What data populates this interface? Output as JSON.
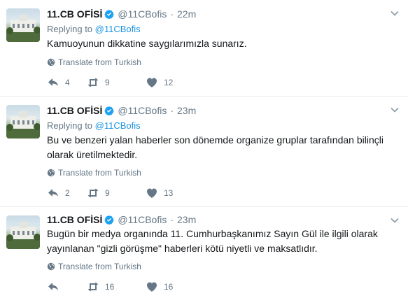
{
  "tweets": [
    {
      "name": "11.CB OFİSİ",
      "handle": "@11CBofis",
      "separator": "·",
      "time": "22m",
      "replying_prefix": "Replying to",
      "replying_handle": "@11CBofis",
      "text": "Kamuoyunun dikkatine saygılarımızla sunarız.",
      "translate_label": "Translate from Turkish",
      "replies": "4",
      "retweets": "9",
      "likes": "12"
    },
    {
      "name": "11.CB OFİSİ",
      "handle": "@11CBofis",
      "separator": "·",
      "time": "23m",
      "replying_prefix": "Replying to",
      "replying_handle": "@11CBofis",
      "text": "Bu ve benzeri yalan haberler son dönemde organize gruplar tarafından bilinçli olarak üretilmektedir.",
      "translate_label": "Translate from Turkish",
      "replies": "2",
      "retweets": "9",
      "likes": "13"
    },
    {
      "name": "11.CB OFİSİ",
      "handle": "@11CBofis",
      "separator": "·",
      "time": "23m",
      "text": "Bugün bir medya organında 11. Cumhurbaşkanımız Sayın Gül ile ilgili olarak yayınlanan \"gizli görüşme\" haberleri kötü niyetli ve maksatlıdır.",
      "translate_label": "Translate from Turkish",
      "replies": "",
      "retweets": "16",
      "likes": "16"
    }
  ],
  "colors": {
    "verified": "#1da1f2",
    "mention": "#1b95e0",
    "muted": "#657786",
    "divider": "#e6ecf0"
  },
  "icons": [
    "verified-badge-icon",
    "chevron-down-icon",
    "globe-icon",
    "reply-icon",
    "retweet-icon",
    "heart-icon"
  ]
}
